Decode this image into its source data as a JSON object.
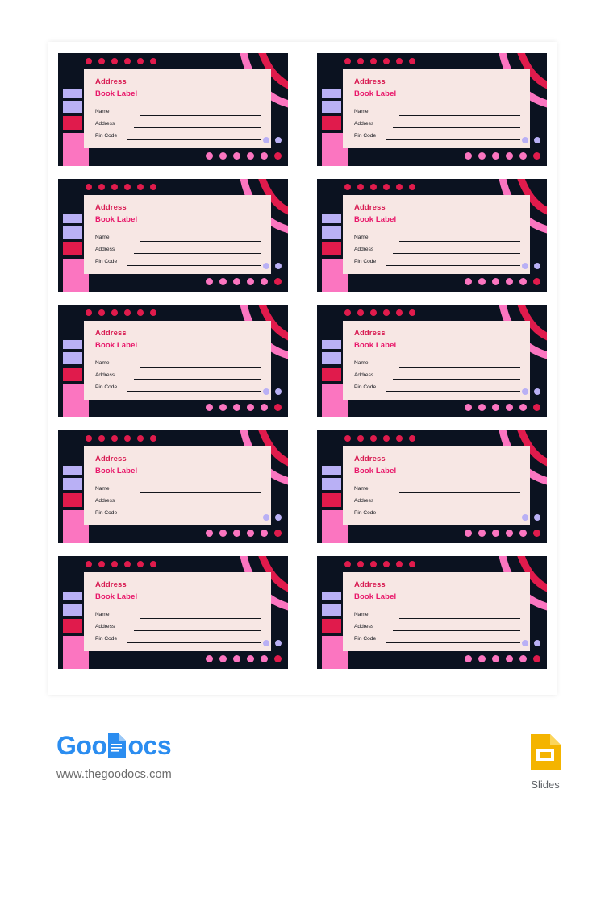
{
  "document": {
    "type": "address-book-label-sheet",
    "page_background": "#ffffff",
    "sheet_background": "#ffffff"
  },
  "palette": {
    "card_bg": "#0b1220",
    "panel_bg": "#f7e7e4",
    "crimson": "#e01b4c",
    "title_crimson": "#d81b52",
    "title_pink": "#e8186a",
    "hot_pink": "#fb75c0",
    "lavender": "#b9b0f5",
    "ink": "#14161c",
    "brand_blue": "#2b8df0",
    "slides_amber": "#f4b400"
  },
  "label_template": {
    "title_line_1": "Address",
    "title_line_2": "Book Label",
    "fields": [
      {
        "label": "Name"
      },
      {
        "label": "Address"
      },
      {
        "label": "Pin Code"
      }
    ],
    "decor": {
      "top_dots_count": 6,
      "top_dots_color": "#e01b4c",
      "bottom_dots_count": 6,
      "bottom_dots_color": "#fb75c0",
      "bottom_dots_accent_color": "#e01b4c",
      "lavender_dots_count": 2,
      "lavender_dots_color": "#b9b0f5",
      "left_bars": [
        "#b9b0f5",
        "#b9b0f5",
        "#e01b4c",
        "#fb75c0"
      ],
      "arc_colors": [
        "#fb75c0",
        "#e01b4c"
      ]
    }
  },
  "grid": {
    "columns": 2,
    "rows": 5,
    "total_labels": 10
  },
  "labels": [
    {
      "title_line_1": "Address",
      "title_line_2": "Book Label",
      "field_1": "Name",
      "field_2": "Address",
      "field_3": "Pin Code"
    },
    {
      "title_line_1": "Address",
      "title_line_2": "Book Label",
      "field_1": "Name",
      "field_2": "Address",
      "field_3": "Pin Code"
    },
    {
      "title_line_1": "Address",
      "title_line_2": "Book Label",
      "field_1": "Name",
      "field_2": "Address",
      "field_3": "Pin Code"
    },
    {
      "title_line_1": "Address",
      "title_line_2": "Book Label",
      "field_1": "Name",
      "field_2": "Address",
      "field_3": "Pin Code"
    },
    {
      "title_line_1": "Address",
      "title_line_2": "Book Label",
      "field_1": "Name",
      "field_2": "Address",
      "field_3": "Pin Code"
    },
    {
      "title_line_1": "Address",
      "title_line_2": "Book Label",
      "field_1": "Name",
      "field_2": "Address",
      "field_3": "Pin Code"
    },
    {
      "title_line_1": "Address",
      "title_line_2": "Book Label",
      "field_1": "Name",
      "field_2": "Address",
      "field_3": "Pin Code"
    },
    {
      "title_line_1": "Address",
      "title_line_2": "Book Label",
      "field_1": "Name",
      "field_2": "Address",
      "field_3": "Pin Code"
    },
    {
      "title_line_1": "Address",
      "title_line_2": "Book Label",
      "field_1": "Name",
      "field_2": "Address",
      "field_3": "Pin Code"
    },
    {
      "title_line_1": "Address",
      "title_line_2": "Book Label",
      "field_1": "Name",
      "field_2": "Address",
      "field_3": "Pin Code"
    }
  ],
  "footer": {
    "brand_part_1": "Goo",
    "brand_part_2": "ocs",
    "brand_icon": "document-icon",
    "url": "www.thegoodocs.com",
    "slides_label": "Slides",
    "slides_icon": "google-slides-icon"
  }
}
